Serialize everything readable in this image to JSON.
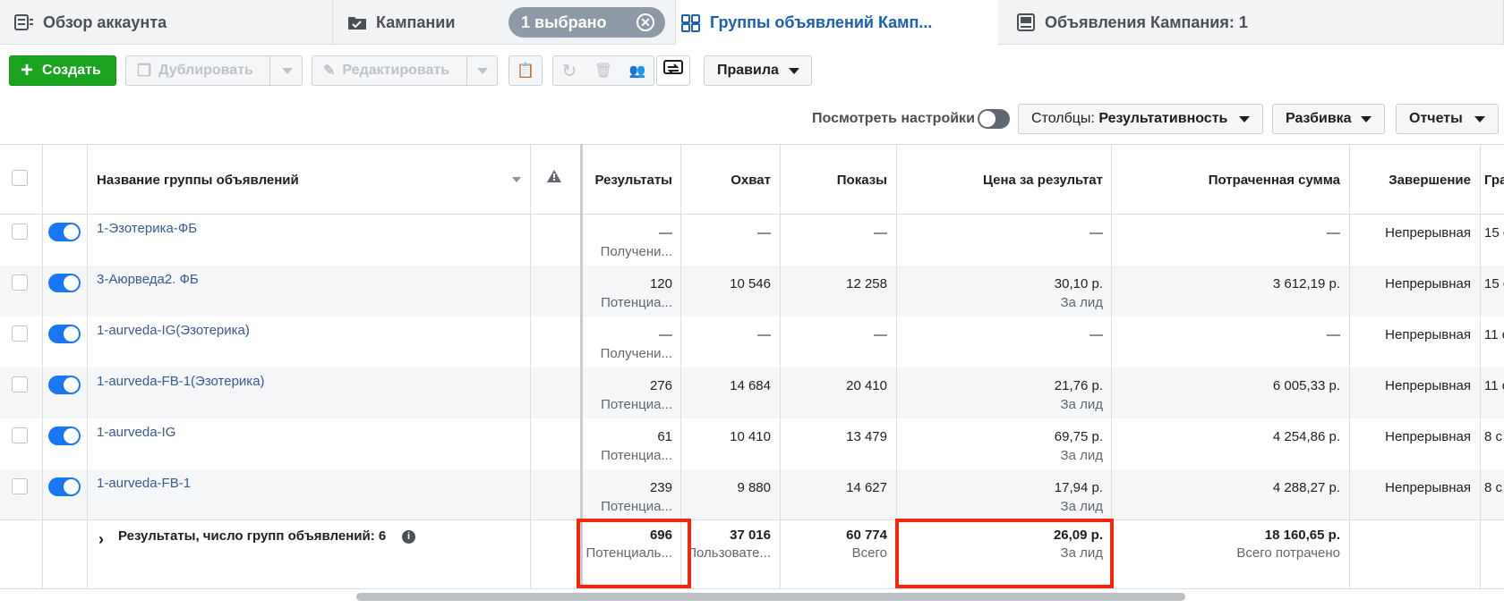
{
  "tabs": [
    {
      "label": "Обзор аккаунта",
      "icon": "account-overview-icon"
    },
    {
      "label": "Кампании",
      "icon": "campaigns-folder-icon"
    },
    {
      "label": "Группы объявлений Камп...",
      "icon": "ad-sets-grid-icon"
    },
    {
      "label": "Объявления Кампания: 1",
      "icon": "ads-icon"
    }
  ],
  "selection_pill": {
    "label": "1 выбрано",
    "close_glyph": "⊗"
  },
  "toolbar": {
    "create_label": "Создать",
    "duplicate_label": "Дублировать",
    "edit_label": "Редактировать",
    "rules_label": "Правила"
  },
  "view_settings": {
    "label": "Посмотреть настройки"
  },
  "dropdowns": {
    "columns_prefix": "Столбцы:",
    "columns_value": "Результативность",
    "breakdown": "Разбивка",
    "reports": "Отчеты"
  },
  "table": {
    "headers": {
      "name": "Название группы объявлений",
      "results": "Результаты",
      "reach": "Охват",
      "impressions": "Показы",
      "cost_per_result": "Цена за результат",
      "amount_spent": "Потраченная сумма",
      "ends": "Завершение",
      "schedule": "Гра"
    },
    "rows": [
      {
        "name": "1-Эзотерика-ФБ",
        "results": "—",
        "results_sub": "Получени...",
        "reach": "—",
        "impressions": "—",
        "cpr": "—",
        "cpr_sub": "",
        "spent": "—",
        "ends": "Непрерывная",
        "schedule": "15 с"
      },
      {
        "name": "3-Аюрведа2. ФБ",
        "results": "120",
        "results_sub": "Потенциа...",
        "reach": "10 546",
        "impressions": "12 258",
        "cpr": "30,10 р.",
        "cpr_sub": "За лид",
        "spent": "3 612,19 р.",
        "ends": "Непрерывная",
        "schedule": "15 с"
      },
      {
        "name": "1-aurveda-IG(Эзотерика)",
        "results": "—",
        "results_sub": "Получени...",
        "reach": "—",
        "impressions": "—",
        "cpr": "—",
        "cpr_sub": "",
        "spent": "—",
        "ends": "Непрерывная",
        "schedule": "11 с"
      },
      {
        "name": "1-aurveda-FB-1(Эзотерика)",
        "results": "276",
        "results_sub": "Потенциа...",
        "reach": "14 684",
        "impressions": "20 410",
        "cpr": "21,76 р.",
        "cpr_sub": "За лид",
        "spent": "6 005,33 р.",
        "ends": "Непрерывная",
        "schedule": "11 с"
      },
      {
        "name": "1-aurveda-IG",
        "results": "61",
        "results_sub": "Потенциа...",
        "reach": "10 410",
        "impressions": "13 479",
        "cpr": "69,75 р.",
        "cpr_sub": "За лид",
        "spent": "4 254,86 р.",
        "ends": "Непрерывная",
        "schedule": "8 с"
      },
      {
        "name": "1-aurveda-FB-1",
        "results": "239",
        "results_sub": "Потенциа...",
        "reach": "9 880",
        "impressions": "14 627",
        "cpr": "17,94 р.",
        "cpr_sub": "За лид",
        "spent": "4 288,27 р.",
        "ends": "Непрерывная",
        "schedule": "8 с"
      }
    ],
    "totals": {
      "label": "Результаты, число групп объявлений: 6",
      "results": "696",
      "results_sub": "Потенциаль...",
      "reach": "37 016",
      "reach_sub": "Пользовате...",
      "impressions": "60 774",
      "impressions_sub": "Всего",
      "cpr": "26,09 р.",
      "cpr_sub": "За лид",
      "spent": "18 160,65 р.",
      "spent_sub": "Всего потрачено"
    }
  },
  "colors": {
    "accent": "#1877f2",
    "create": "#1aa31f",
    "highlight": "#f5250e",
    "link": "#385898"
  }
}
